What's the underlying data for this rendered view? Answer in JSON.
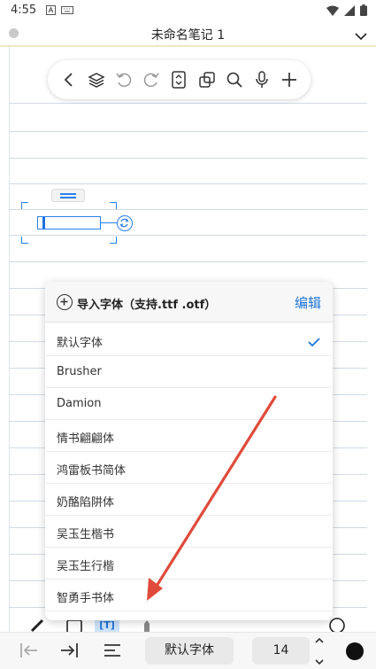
{
  "status_bar": {
    "time": "4:55"
  },
  "title_bar": {
    "title": "未命名笔记 1"
  },
  "toolbar": {
    "items": [
      {
        "icon": "back-icon"
      },
      {
        "icon": "layers-icon"
      },
      {
        "icon": "undo-icon"
      },
      {
        "icon": "redo-icon"
      },
      {
        "icon": "page-icon"
      },
      {
        "icon": "copy-icon"
      },
      {
        "icon": "search-icon"
      },
      {
        "icon": "microphone-icon"
      },
      {
        "icon": "add-icon"
      }
    ]
  },
  "font_panel": {
    "import_label": "导入字体（支持.ttf .otf）",
    "edit_label": "编辑",
    "selected_index": 0,
    "fonts": [
      "默认字体",
      "Brusher",
      "Damion",
      "情书翩翩体",
      "鸿雷板书简体",
      "奶酪陷阱体",
      "吴玉生楷书",
      "吴玉生行楷",
      "智勇手书体"
    ]
  },
  "bottom_bar": {
    "font_name": "默认字体",
    "font_size": "14",
    "color": "#111111"
  },
  "colors": {
    "accent": "#1e74d8",
    "arrow": "#e04a3a",
    "selection": "#2a7ff0"
  }
}
